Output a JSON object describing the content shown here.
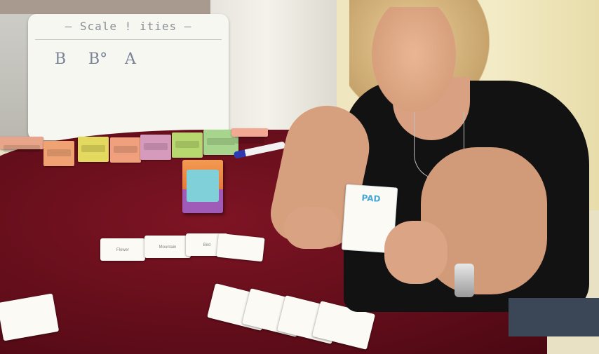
{
  "whiteboard": {
    "title": "— Scale !     ities —",
    "letters": [
      "B",
      "B°",
      "A"
    ]
  },
  "table_cards": [
    {
      "label": "Flower"
    },
    {
      "label": "Mountain"
    },
    {
      "label": "Bird"
    },
    {
      "label": ""
    }
  ],
  "held_card": {
    "label": "PAD"
  },
  "colors": {
    "tablecloth": "#6e1020",
    "wall": "#f0e7c0",
    "shirt": "#121212"
  }
}
